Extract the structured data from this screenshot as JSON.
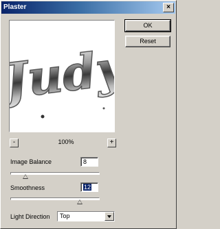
{
  "window": {
    "title": "Plaster",
    "close_glyph": "×"
  },
  "buttons": {
    "ok": "OK",
    "reset": "Reset"
  },
  "preview": {
    "sample_text": "Judy",
    "zoom": "100%",
    "zoom_out": "-",
    "zoom_in": "+"
  },
  "controls": {
    "image_balance": {
      "label": "Image Balance",
      "value": "8",
      "slider_fraction": 0.16
    },
    "smoothness": {
      "label": "Smoothness",
      "value": "12",
      "slider_fraction": 0.8
    },
    "light_direction": {
      "label": "Light Direction",
      "selected": "Top"
    }
  },
  "colors": {
    "dialog_bg": "#d4d0c8",
    "title_start": "#0a246a",
    "title_end": "#a6caf0",
    "selection": "#0a246a"
  }
}
